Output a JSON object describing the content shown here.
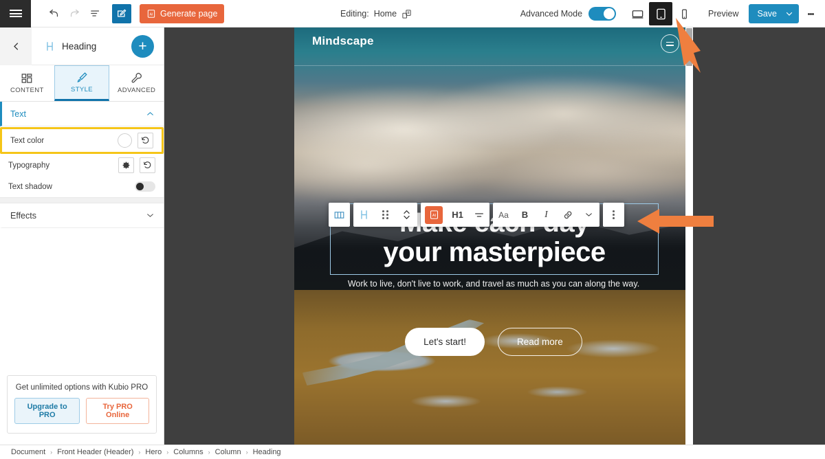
{
  "topbar": {
    "menu_icon": "hamburger-icon",
    "undo_icon": "undo-icon",
    "redo_icon": "redo-icon",
    "history_icon": "history-list-icon",
    "edit_icon": "edit-pencil-icon",
    "generate_label": "Generate page",
    "generate_icon": "ai-sparkle-icon",
    "editing_prefix": "Editing:",
    "editing_page": "Home",
    "page_switch_icon": "page-switch-icon",
    "advanced_mode_label": "Advanced Mode",
    "advanced_mode_on": true,
    "device_desktop_icon": "desktop-icon",
    "device_tablet_icon": "tablet-icon",
    "device_mobile_icon": "mobile-icon",
    "active_device": "tablet",
    "preview_label": "Preview",
    "save_label": "Save",
    "save_caret_icon": "chevron-down-icon",
    "more_icon": "kebab-menu-icon",
    "accent_blue": "#1e8cbe",
    "accent_orange": "#e8663c"
  },
  "sidebar": {
    "back_icon": "chevron-left-icon",
    "element_icon": "heading-h-icon",
    "element_title": "Heading",
    "add_label": "+",
    "tabs": [
      {
        "label": "CONTENT",
        "icon": "layout-blocks-icon",
        "active": false
      },
      {
        "label": "STYLE",
        "icon": "paint-brush-icon",
        "active": true
      },
      {
        "label": "ADVANCED",
        "icon": "wrench-icon",
        "active": false
      }
    ],
    "sections": [
      {
        "title": "Text",
        "expanded": true,
        "caret_icon": "chevron-up-icon"
      },
      {
        "title": "Effects",
        "expanded": false,
        "caret_icon": "chevron-down-icon"
      }
    ],
    "controls": [
      {
        "label": "Text color",
        "type": "color",
        "value": "#ffffff",
        "reset_icon": "reset-icon",
        "highlighted": true
      },
      {
        "label": "Typography",
        "type": "settings",
        "settings_icon": "gear-icon",
        "reset_icon": "reset-icon",
        "highlighted": false
      },
      {
        "label": "Text shadow",
        "type": "toggle",
        "value": false,
        "highlighted": false
      }
    ],
    "pro": {
      "text": "Get unlimited options with Kubio PRO",
      "upgrade_label": "Upgrade to PRO",
      "try_label": "Try PRO Online"
    }
  },
  "float_toolbar": {
    "groups": [
      {
        "items": [
          {
            "icon": "columns-icon",
            "name": "column-layout-button"
          }
        ]
      },
      {
        "items": [
          {
            "icon": "heading-h-icon",
            "name": "heading-element-button"
          },
          {
            "icon": "drag-handle-icon",
            "name": "drag-handle-button"
          },
          {
            "icon": "move-updown-icon",
            "name": "move-vertical-button"
          }
        ]
      },
      {
        "items": [
          {
            "icon": "ai-sparkle-icon",
            "name": "ai-generate-button",
            "accent": true
          },
          {
            "icon": "h1-label",
            "label": "H1",
            "name": "heading-level-button"
          },
          {
            "icon": "align-center-icon",
            "name": "align-button"
          }
        ]
      },
      {
        "items": [
          {
            "icon": "font-size-icon",
            "label": "Aa",
            "name": "font-size-button"
          },
          {
            "icon": "bold-icon",
            "label": "B",
            "name": "bold-button"
          },
          {
            "icon": "italic-icon",
            "label": "I",
            "name": "italic-button"
          },
          {
            "icon": "link-icon",
            "name": "link-button"
          },
          {
            "icon": "chevron-down-icon",
            "name": "more-format-button"
          }
        ]
      },
      {
        "items": [
          {
            "icon": "kebab-menu-icon",
            "name": "toolbar-more-button"
          }
        ]
      }
    ]
  },
  "canvas": {
    "brand": "Mindscape",
    "menu_icon": "hamburger-circle-icon",
    "heading": "Make each day your masterpiece",
    "heading_line1": "Make each day",
    "heading_line2": "your masterpiece",
    "subtitle": "Work to live, don't live to work, and travel as much as you can along the way.",
    "cta_primary": "Let's start!",
    "cta_secondary": "Read more"
  },
  "breadcrumb": {
    "items": [
      "Document",
      "Front Header (Header)",
      "Hero",
      "Columns",
      "Column",
      "Heading"
    ],
    "separator": "›"
  }
}
